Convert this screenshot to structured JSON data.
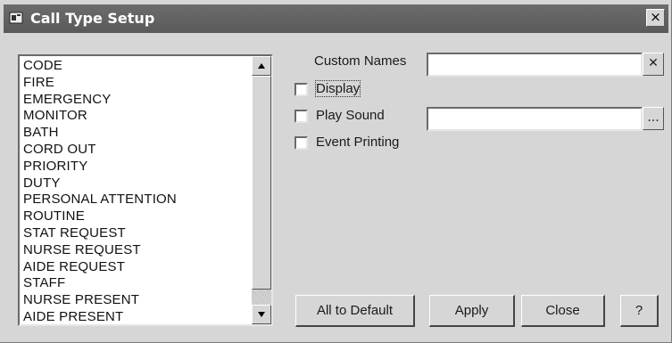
{
  "window": {
    "title": "Call Type Setup",
    "close_glyph": "×",
    "icon": "phone-window-icon"
  },
  "call_types": {
    "items": [
      "CODE",
      "FIRE",
      "EMERGENCY",
      "MONITOR",
      "BATH",
      "CORD OUT",
      "PRIORITY",
      "DUTY",
      "PERSONAL ATTENTION",
      "ROUTINE",
      "STAT REQUEST",
      "NURSE REQUEST",
      "AIDE REQUEST",
      "STAFF",
      "NURSE PRESENT",
      "AIDE PRESENT"
    ]
  },
  "form": {
    "custom_names_label": "Custom Names",
    "custom_names_value": "",
    "clear_glyph": "✕",
    "display_label": "Display",
    "display_checked": false,
    "play_sound_label": "Play Sound",
    "play_sound_checked": false,
    "sound_file_value": "",
    "browse_glyph": "...",
    "event_printing_label": "Event Printing",
    "event_printing_checked": false
  },
  "buttons": {
    "all_default": "All to Default",
    "apply": "Apply",
    "close": "Close",
    "help": "?"
  }
}
